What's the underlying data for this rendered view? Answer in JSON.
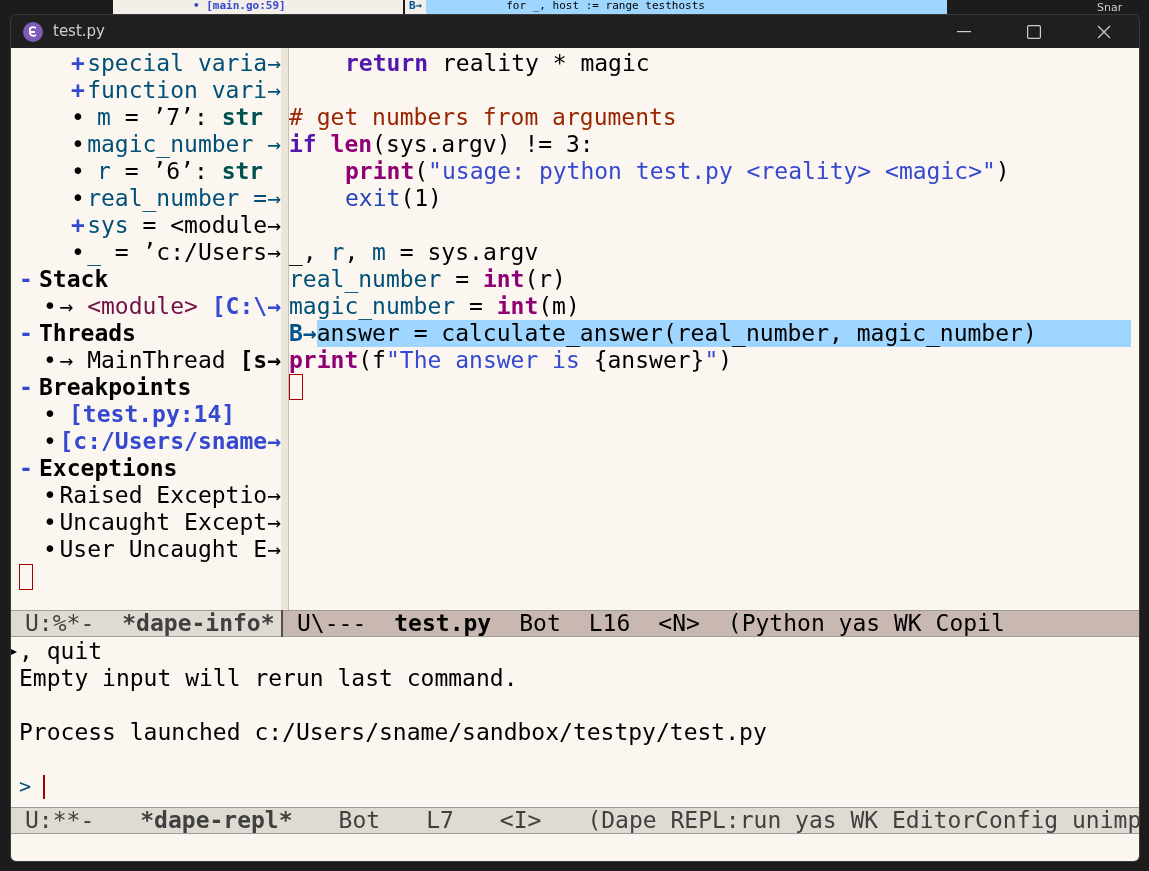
{
  "background": {
    "left_text": "• [main.go:59]",
    "marker": "B→",
    "code": "for _, host := range testhosts",
    "right_text": "Snar"
  },
  "window": {
    "title": "test.py"
  },
  "info_panel": {
    "sections": [
      {
        "items": [
          {
            "marker": "+",
            "segments": [
              {
                "text": "special varia→",
                "kind": "var"
              }
            ]
          },
          {
            "marker": "+",
            "segments": [
              {
                "text": "function vari→",
                "kind": "var"
              }
            ]
          },
          {
            "marker": "•",
            "segments": [
              {
                "text": "m",
                "kind": "var"
              },
              {
                "text": " = ’7’: ",
                "kind": "plain"
              },
              {
                "text": "str",
                "kind": "type"
              }
            ]
          },
          {
            "marker": "•",
            "segments": [
              {
                "text": "magic_number →",
                "kind": "var"
              }
            ]
          },
          {
            "marker": "•",
            "segments": [
              {
                "text": "r",
                "kind": "var"
              },
              {
                "text": " = ’6’: ",
                "kind": "plain"
              },
              {
                "text": "str",
                "kind": "type"
              }
            ]
          },
          {
            "marker": "•",
            "segments": [
              {
                "text": "real_number =→",
                "kind": "var"
              }
            ]
          },
          {
            "marker": "+",
            "segments": [
              {
                "text": "sys",
                "kind": "var"
              },
              {
                "text": " = <module→",
                "kind": "plain"
              }
            ]
          },
          {
            "marker": "•",
            "segments": [
              {
                "text": "_",
                "kind": "var"
              },
              {
                "text": " = ’c:/Users→",
                "kind": "plain"
              }
            ]
          }
        ]
      },
      {
        "toggle": "-",
        "title": "Stack",
        "items": [
          {
            "marker": "•",
            "segments": [
              {
                "text": "→ ",
                "kind": "plain"
              },
              {
                "text": "<module> ",
                "kind": "func"
              },
              {
                "text": "[C:\\→",
                "kind": "link"
              }
            ]
          }
        ]
      },
      {
        "toggle": "-",
        "title": "Threads",
        "items": [
          {
            "marker": "•",
            "segments": [
              {
                "text": "→ MainThread ",
                "kind": "plain"
              },
              {
                "text": "[s→",
                "kind": "bold"
              }
            ]
          }
        ]
      },
      {
        "toggle": "-",
        "title": "Breakpoints",
        "items": [
          {
            "marker": "•",
            "segments": [
              {
                "text": "[test.py:14]",
                "kind": "link"
              }
            ]
          },
          {
            "marker": "•",
            "segments": [
              {
                "text": "[c:/Users/sname→",
                "kind": "link"
              }
            ]
          }
        ]
      },
      {
        "toggle": "-",
        "title": "Exceptions",
        "items": [
          {
            "marker": "•",
            "segments": [
              {
                "text": "Raised Exceptio→",
                "kind": "plain"
              }
            ]
          },
          {
            "marker": "•",
            "segments": [
              {
                "text": "Uncaught Except→",
                "kind": "plain"
              }
            ]
          },
          {
            "marker": "•",
            "segments": [
              {
                "text": "User Uncaught E→",
                "kind": "plain"
              }
            ]
          }
        ]
      }
    ]
  },
  "code_lines": [
    {
      "kind": "indented",
      "selected": false,
      "segments": [
        {
          "text": "return",
          "kind": "keyword"
        },
        {
          "text": " reality * magic",
          "kind": "plain"
        }
      ]
    },
    {
      "kind": "blank",
      "selected": false
    },
    {
      "kind": "code",
      "selected": false,
      "segments": [
        {
          "text": "# get numbers from arguments",
          "kind": "comment"
        }
      ]
    },
    {
      "kind": "code",
      "selected": false,
      "segments": [
        {
          "text": "if ",
          "kind": "keyword"
        },
        {
          "text": "len",
          "kind": "builtin"
        },
        {
          "text": "(sys.argv) != 3:",
          "kind": "plain"
        }
      ]
    },
    {
      "kind": "indented",
      "selected": false,
      "segments": [
        {
          "text": "print",
          "kind": "builtin"
        },
        {
          "text": "(",
          "kind": "plain"
        },
        {
          "text": "\"usage: python test.py <reality> <magic>\"",
          "kind": "string"
        },
        {
          "text": ")",
          "kind": "plain"
        }
      ]
    },
    {
      "kind": "indented",
      "selected": false,
      "segments": [
        {
          "text": "exit",
          "kind": "call"
        },
        {
          "text": "(1)",
          "kind": "plain"
        }
      ]
    },
    {
      "kind": "blank",
      "selected": false
    },
    {
      "kind": "code",
      "selected": false,
      "segments": [
        {
          "text": "_, ",
          "kind": "plain"
        },
        {
          "text": "r",
          "kind": "var"
        },
        {
          "text": ", ",
          "kind": "plain"
        },
        {
          "text": "m",
          "kind": "var"
        },
        {
          "text": " = sys.argv",
          "kind": "plain"
        }
      ]
    },
    {
      "kind": "code",
      "selected": false,
      "segments": [
        {
          "text": "real_number",
          "kind": "var"
        },
        {
          "text": " = ",
          "kind": "plain"
        },
        {
          "text": "int",
          "kind": "builtin"
        },
        {
          "text": "(r)",
          "kind": "plain"
        }
      ]
    },
    {
      "kind": "code",
      "selected": false,
      "segments": [
        {
          "text": "magic_number",
          "kind": "var"
        },
        {
          "text": " = ",
          "kind": "plain"
        },
        {
          "text": "int",
          "kind": "builtin"
        },
        {
          "text": "(m)",
          "kind": "plain"
        }
      ]
    },
    {
      "kind": "code",
      "selected": true,
      "gutter": "B→",
      "segments": [
        {
          "text": "answer = calculate_answer(real_number, magic_number)",
          "kind": "plain"
        }
      ]
    },
    {
      "kind": "code",
      "selected": false,
      "segments": [
        {
          "text": "print",
          "kind": "builtin"
        },
        {
          "text": "(f",
          "kind": "plain"
        },
        {
          "text": "\"The answer is ",
          "kind": "string"
        },
        {
          "text": "{answer}",
          "kind": "plain"
        },
        {
          "text": "\"",
          "kind": "string"
        },
        {
          "text": ")",
          "kind": "plain"
        }
      ]
    }
  ],
  "info_modeline": {
    "active": false,
    "segments": [
      {
        "text": "U:%*-",
        "bold": false
      },
      {
        "text": "*dape-info*",
        "bold": true
      }
    ]
  },
  "editor_modeline": {
    "active": true,
    "segments": [
      {
        "text": "U\\---",
        "bold": false
      },
      {
        "text": "test.py",
        "bold": true
      },
      {
        "text": "Bot",
        "bold": false
      },
      {
        "text": "L16",
        "bold": false
      },
      {
        "text": "<N>",
        "bold": false
      },
      {
        "text": "(Python yas WK Copil",
        "bold": false
      }
    ]
  },
  "repl": {
    "lines": [
      {
        "kind": "text",
        "text": ", quit"
      },
      {
        "kind": "text",
        "text": "Empty input will rerun last command."
      },
      {
        "kind": "blank"
      },
      {
        "kind": "text",
        "text": "Process launched c:/Users/sname/sandbox/testpy/test.py"
      },
      {
        "kind": "blank"
      }
    ],
    "prompt": ">"
  },
  "repl_modeline": {
    "active": false,
    "segments": [
      {
        "text": "U:**-",
        "bold": false
      },
      {
        "text": "*dape-repl*",
        "bold": true
      },
      {
        "text": "Bot",
        "bold": false
      },
      {
        "text": "L7",
        "bold": false
      },
      {
        "text": "<I>",
        "bold": false
      },
      {
        "text": "(Dape REPL:run yas WK EditorConfig unimp",
        "bold": false
      }
    ]
  }
}
